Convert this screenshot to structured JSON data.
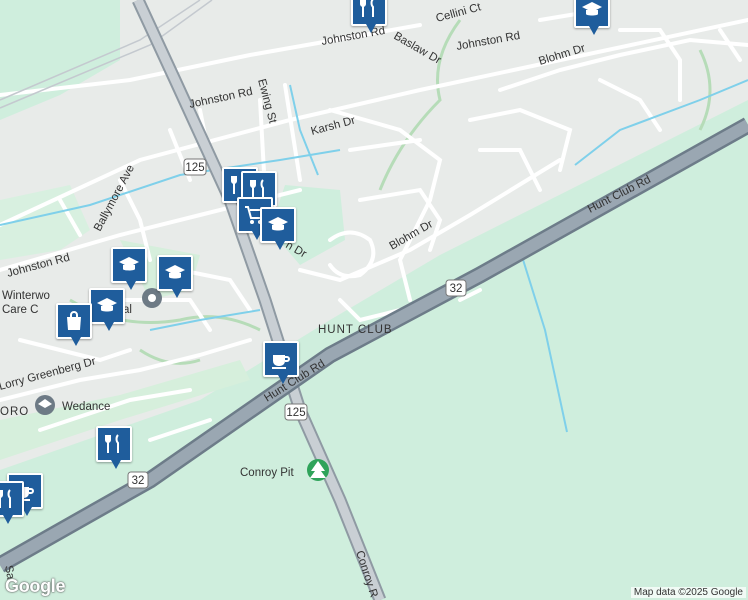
{
  "map": {
    "colors": {
      "land": "#cfeedd",
      "urban": "#e9ecef",
      "road": "#ffffff",
      "highway": "#8a9aa8",
      "water": "#7fd0ea",
      "path": "#a9d8a9"
    },
    "streets": {
      "johnston_1": "Johnston Rd",
      "johnston_2": "Johnston Rd",
      "johnston_3": "Johnston Rd",
      "johnston_4": "Johnston Rd",
      "cellini": "Cellini Ct",
      "baslaw": "Baslaw Dr",
      "blohm_1": "Blohm Dr",
      "blohm_2": "Blohm Dr",
      "ewing": "Ewing St",
      "karsh": "Karsh Dr",
      "ballymore": "Ballymore Ave",
      "hunt_club_rd_1": "Hunt Club Rd",
      "hunt_club_rd_2": "Hunt Club Rd",
      "lorry": "Lorry Greenberg Dr",
      "conroy": "Conroy R",
      "partial_dr": "n Dr",
      "partial_sa": "Sa"
    },
    "routes": {
      "r125_a": "125",
      "r125_b": "125",
      "r32_a": "32",
      "r32_b": "32"
    },
    "places": {
      "neighbourhood": "HUNT CLUB",
      "winterworld_1": "Winterwo",
      "winterworld_2": "Care C",
      "winterworld_3": "al",
      "wedance": "Wedance",
      "conroy_pit": "Conroy Pit",
      "area_left": "ORO"
    },
    "attribution": "Map data ©2025 Google",
    "logo": "Google"
  }
}
